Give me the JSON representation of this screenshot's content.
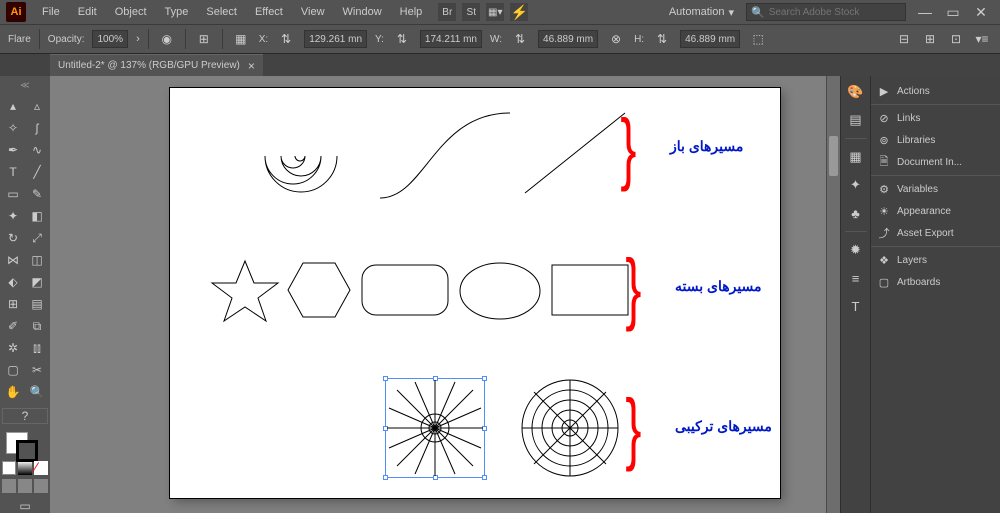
{
  "menu": {
    "items": [
      "File",
      "Edit",
      "Object",
      "Type",
      "Select",
      "Effect",
      "View",
      "Window",
      "Help"
    ],
    "automation": "Automation",
    "search_placeholder": "Search Adobe Stock"
  },
  "controlbar": {
    "tool_name": "Flare",
    "opacity_label": "Opacity:",
    "opacity_value": "100%",
    "x_label": "X:",
    "x_value": "129.261 mn",
    "y_label": "Y:",
    "y_value": "174.211 mn",
    "w_label": "W:",
    "w_value": "46.889 mm",
    "h_label": "H:",
    "h_value": "46.889 mm"
  },
  "document": {
    "tab_title": "Untitled-2* @ 137% (RGB/GPU Preview)"
  },
  "annotations": {
    "row1": "مسیرهای باز",
    "row2": "مسیرهای بسته",
    "row3": "مسیرهای ترکیبی"
  },
  "panels": {
    "items": [
      {
        "icon": "▶",
        "label": "Actions"
      },
      {
        "icon": "⊘",
        "label": "Links"
      },
      {
        "icon": "⊚",
        "label": "Libraries"
      },
      {
        "icon": "🗎",
        "label": "Document In..."
      },
      {
        "icon": "⚙",
        "label": "Variables"
      },
      {
        "icon": "☀",
        "label": "Appearance"
      },
      {
        "icon": "⤴",
        "label": "Asset Export"
      },
      {
        "icon": "❖",
        "label": "Layers"
      },
      {
        "icon": "▢",
        "label": "Artboards"
      }
    ]
  },
  "icon_strip": [
    "🎨",
    "▤",
    "▦",
    "✦",
    "♣",
    "✹",
    "≡",
    "T"
  ],
  "swatch_row": [
    "#ffffff",
    "#000000",
    "#ff0000"
  ]
}
